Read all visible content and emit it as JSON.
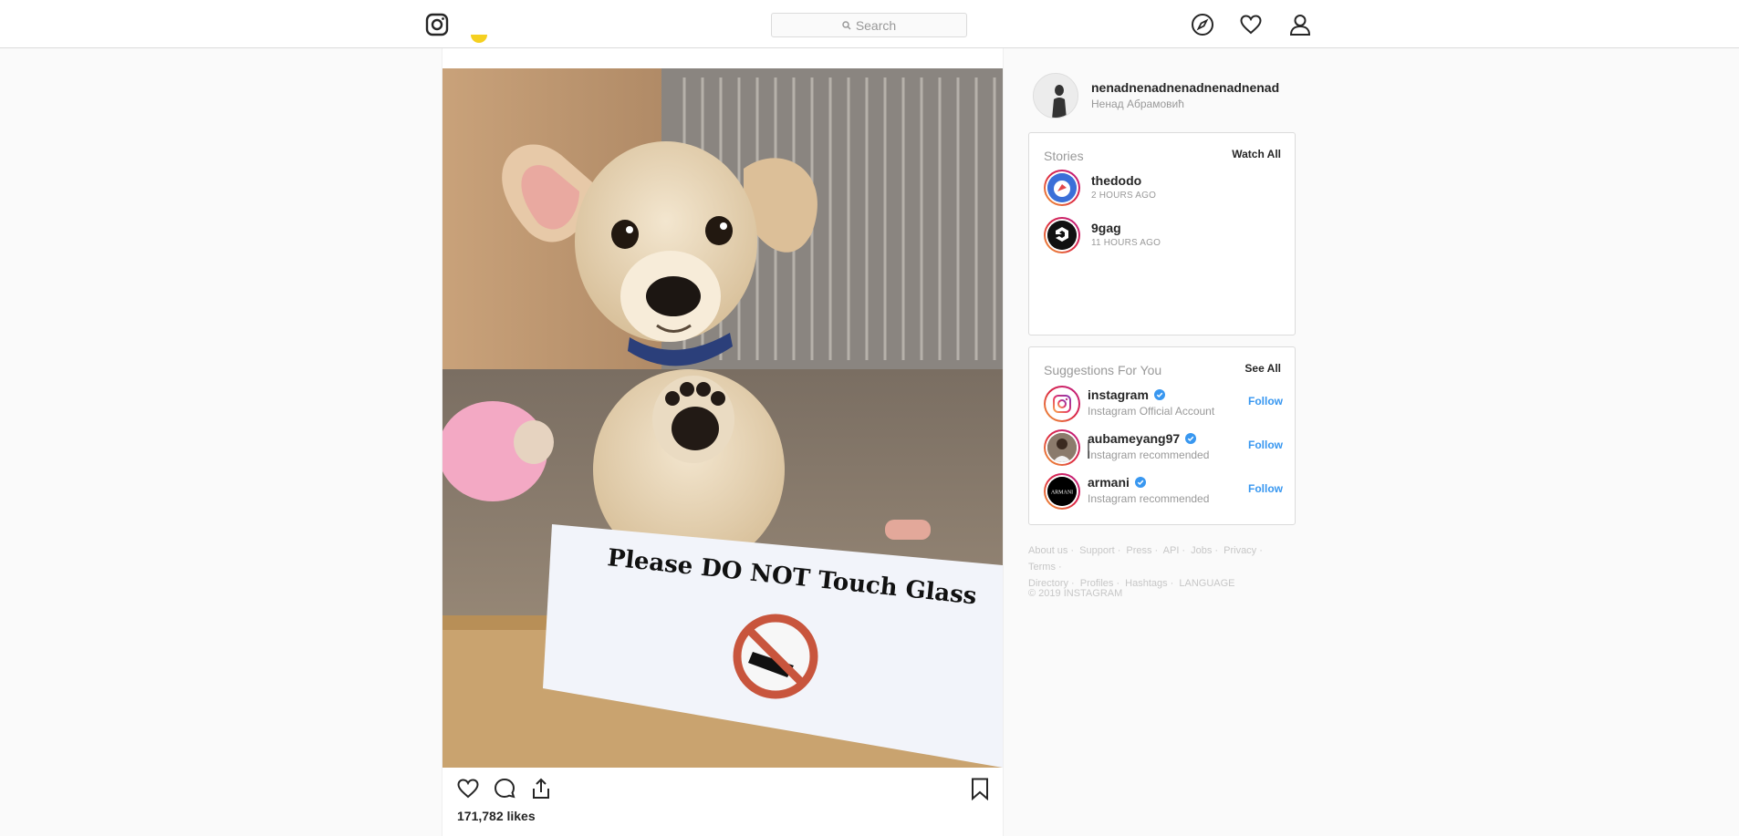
{
  "header": {
    "search_placeholder": "Search",
    "icons": [
      "instagram-logo-icon",
      "search-icon",
      "compass-icon",
      "heart-icon",
      "user-icon"
    ]
  },
  "post": {
    "image_text": "Please DO NOT Touch Glass",
    "likes": "171,782 likes",
    "action_icons": [
      "heart-icon",
      "comment-icon",
      "share-icon",
      "bookmark-icon"
    ]
  },
  "profile": {
    "username": "nenadnenadnenadnenadnenad",
    "full_name": "Ненад Абрамовић"
  },
  "stories": {
    "title": "Stories",
    "watch_all": "Watch All",
    "items": [
      {
        "name": "thedodo",
        "time": "2 hours ago"
      },
      {
        "name": "9gag",
        "time": "11 hours ago"
      }
    ]
  },
  "suggestions": {
    "title": "Suggestions For You",
    "see_all": "See All",
    "follow_label": "Follow",
    "items": [
      {
        "name": "instagram",
        "sub": "Instagram Official Account"
      },
      {
        "name": "aubameyang97",
        "sub": "Instagram recommended"
      },
      {
        "name": "armani",
        "sub": "Instagram recommended",
        "avatar_text": "ARMANI"
      }
    ]
  },
  "footer": {
    "links": [
      "About us",
      "Support",
      "Press",
      "API",
      "Jobs",
      "Privacy",
      "Terms",
      "Directory",
      "Profiles",
      "Hashtags",
      "LANGUAGE"
    ],
    "copyright": "© 2019 INSTAGRAM"
  },
  "colors": {
    "link_blue": "#3897f0",
    "border": "#dbdbdb",
    "muted_text": "#999999",
    "background": "#fafafa"
  }
}
